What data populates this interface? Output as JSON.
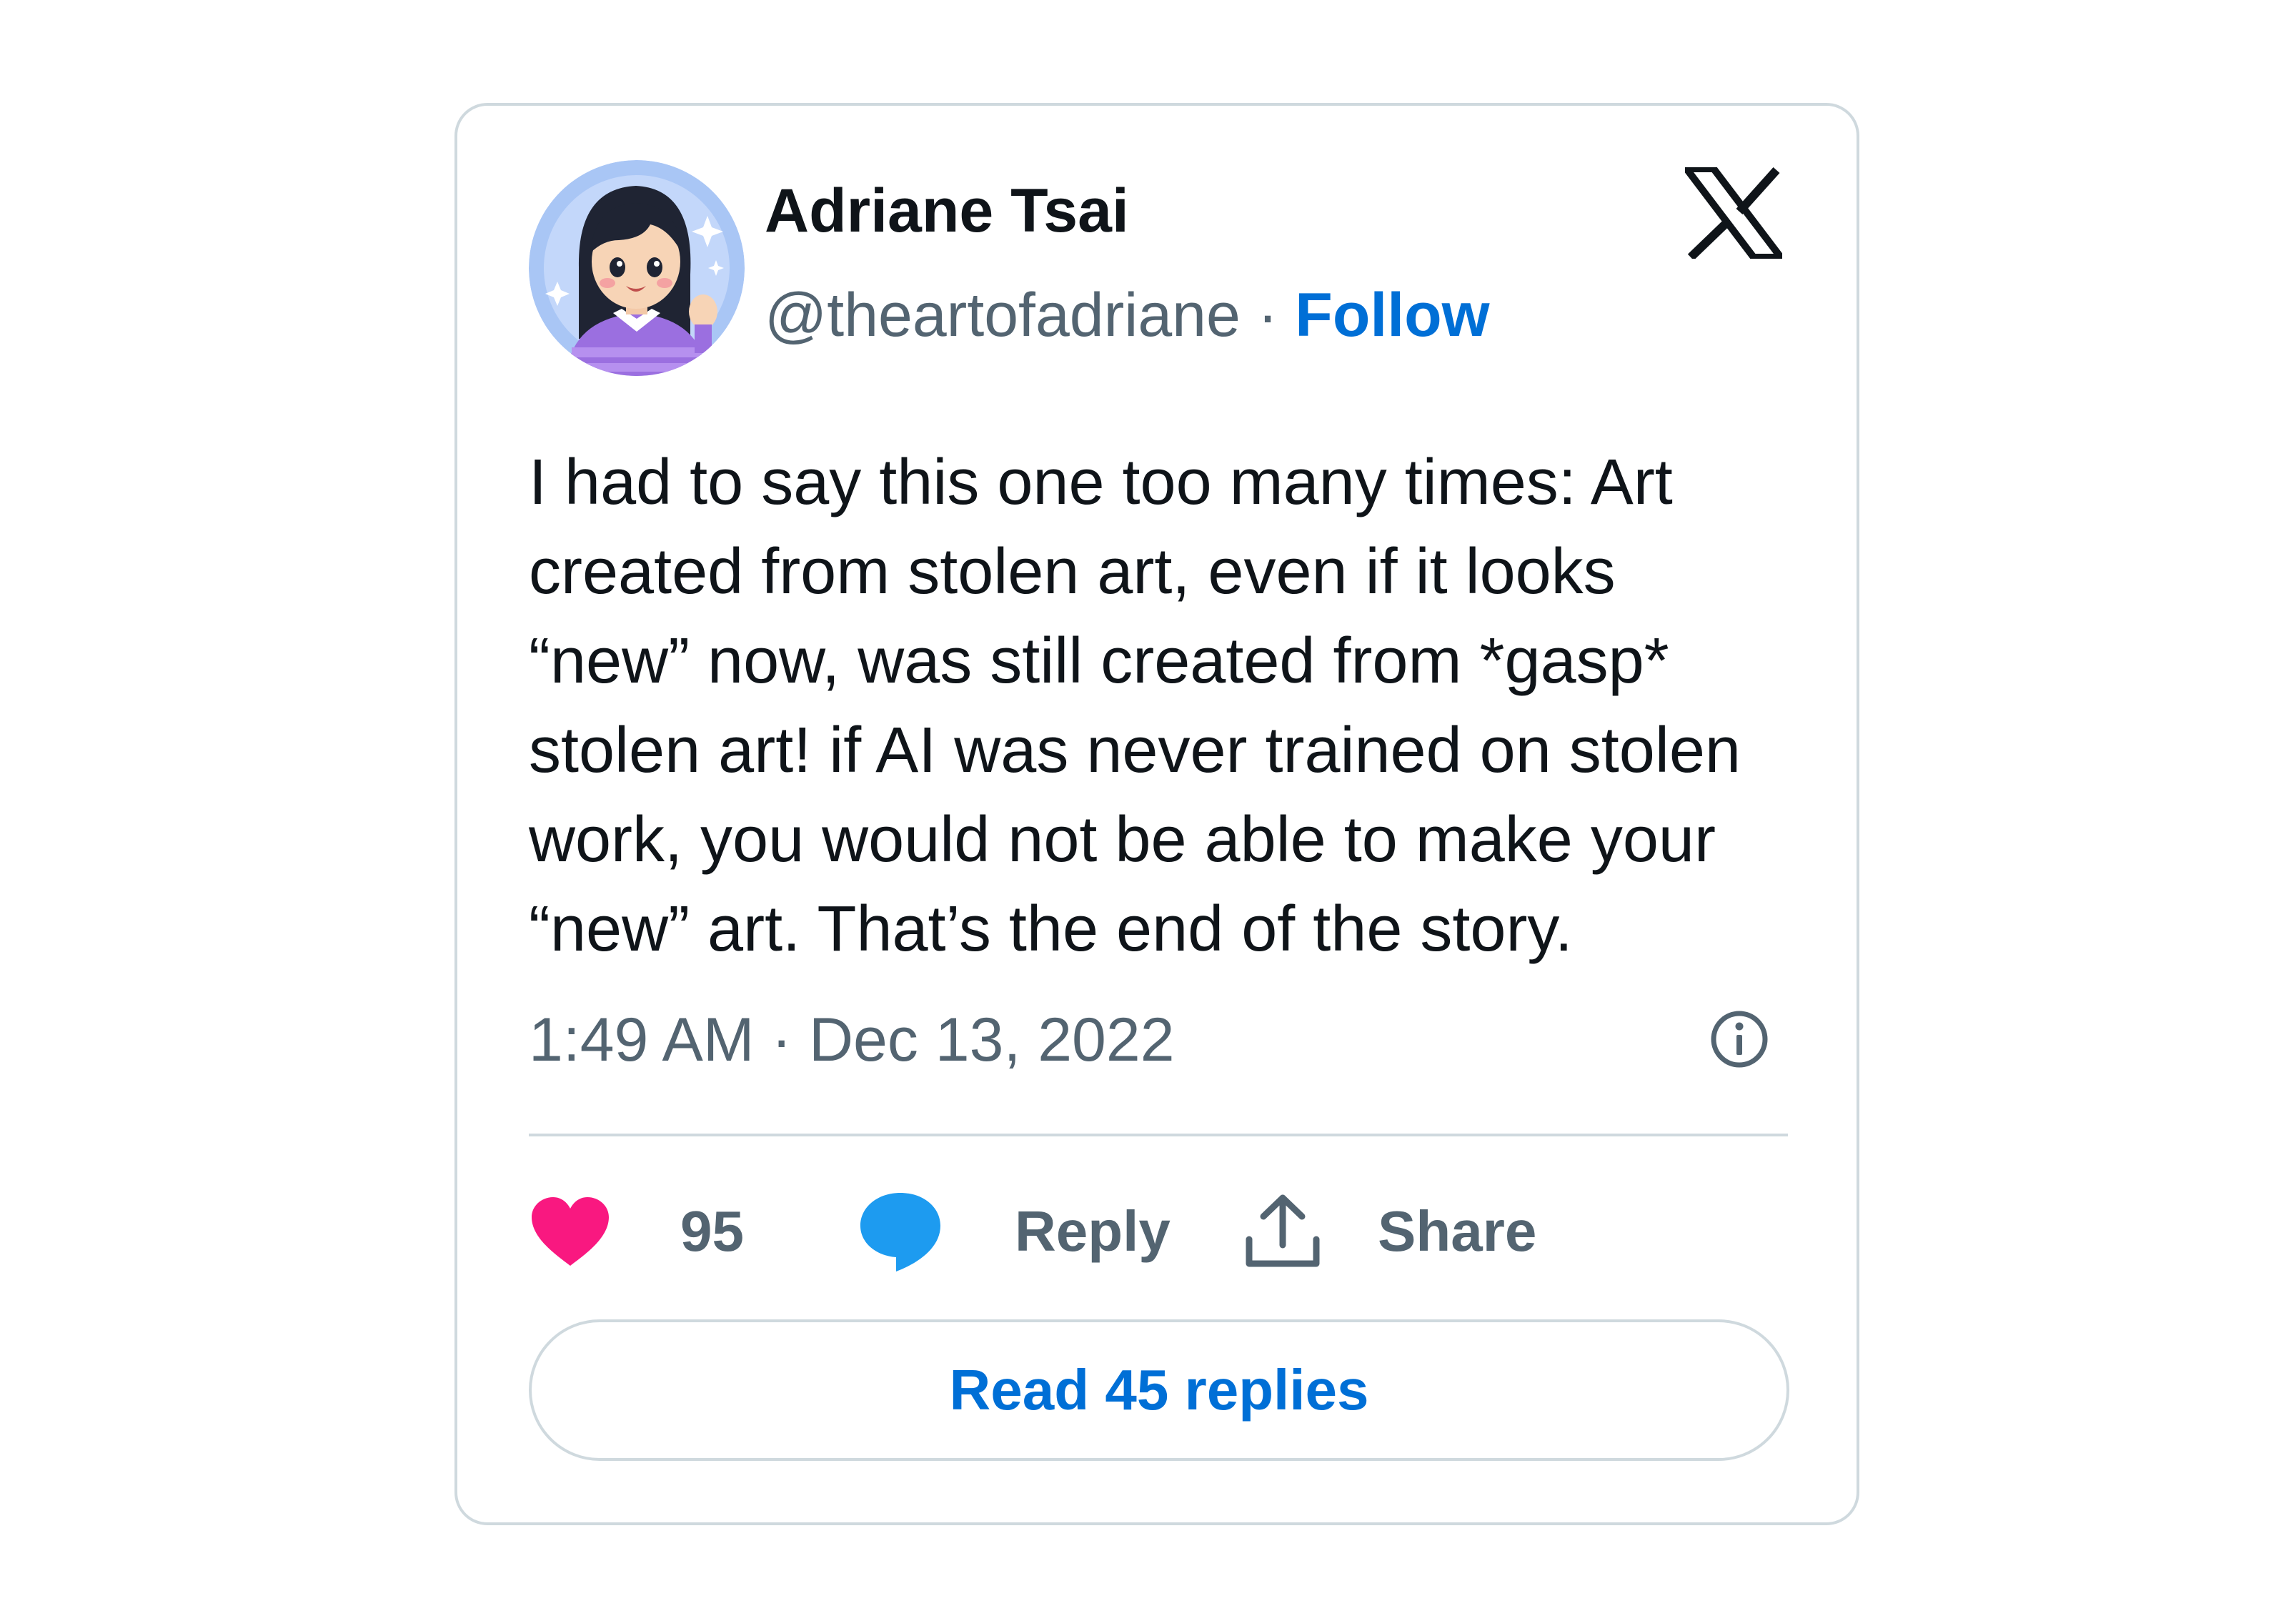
{
  "author": {
    "name": "Adriane Tsai",
    "handle": "@theartofadriane",
    "separator": "·",
    "follow_label": "Follow"
  },
  "tweet": {
    "lines": [
      "I had to say this one too many times: Art",
      "created from stolen art, even if it looks",
      "“new” now, was still created from *gasp*",
      "stolen art! if AI was never trained on stolen",
      "work, you would not be able to make your",
      "“new” art. That’s the end of the story."
    ],
    "timestamp": "1:49 AM · Dec 13, 2022"
  },
  "actions": {
    "like_count": "95",
    "reply_label": "Reply",
    "share_label": "Share",
    "read_replies_label": "Read 45 replies"
  },
  "icons": {
    "brand": "x-logo-icon",
    "like": "heart-icon",
    "reply": "speech-bubble-icon",
    "share": "upload-arrow-icon",
    "info": "info-circle-icon"
  },
  "colors": {
    "text_primary": "#0f1419",
    "text_secondary": "#536471",
    "link": "#006fd6",
    "heart": "#f91880",
    "reply_bubble": "#1d9bf0",
    "border": "#cfd9de",
    "avatar_bg": "#a9c6f5"
  }
}
